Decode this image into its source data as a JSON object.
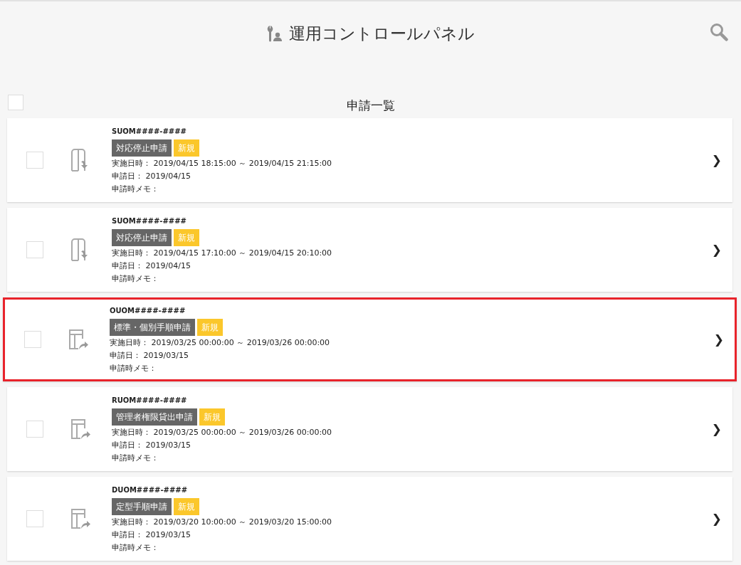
{
  "header": {
    "title": "運用コントロールパネル"
  },
  "list": {
    "title": "申請一覧",
    "select_all": {
      "checked": false
    }
  },
  "rows": [
    {
      "id": "SUOM####-####",
      "kind": "stop",
      "category": "対応停止申請",
      "badge": "新規",
      "lines": [
        "実施日時： 2019/04/15 18:15:00 ～ 2019/04/15 21:15:00",
        "申請日： 2019/04/15",
        "申請時メモ："
      ],
      "checked": false,
      "selected": false,
      "chevron": "❯"
    },
    {
      "id": "SUOM####-####",
      "kind": "stop",
      "category": "対応停止申請",
      "badge": "新規",
      "lines": [
        "実施日時： 2019/04/15 17:10:00 ～ 2019/04/15 20:10:00",
        "申請日： 2019/04/15",
        "申請時メモ："
      ],
      "checked": false,
      "selected": false,
      "chevron": "❯"
    },
    {
      "id": "OUOM####-####",
      "kind": "procedure",
      "category": "標準・個別手順申請",
      "badge": "新規",
      "lines": [
        "実施日時： 2019/03/25 00:00:00 ～ 2019/03/26 00:00:00",
        "申請日： 2019/03/15",
        "申請時メモ："
      ],
      "checked": false,
      "selected": true,
      "chevron": "❯"
    },
    {
      "id": "RUOM####-####",
      "kind": "procedure",
      "category": "管理者権限貸出申請",
      "badge": "新規",
      "lines": [
        "実施日時： 2019/03/25 00:00:00 ～ 2019/03/26 00:00:00",
        "申請日： 2019/03/15",
        "申請時メモ："
      ],
      "checked": false,
      "selected": false,
      "chevron": "❯"
    },
    {
      "id": "DUOM####-####",
      "kind": "procedure",
      "category": "定型手順申請",
      "badge": "新規",
      "lines": [
        "実施日時： 2019/03/20 10:00:00 ～ 2019/03/20 15:00:00",
        "申請日： 2019/03/15",
        "申請時メモ："
      ],
      "checked": false,
      "selected": false,
      "chevron": "❯"
    }
  ]
}
